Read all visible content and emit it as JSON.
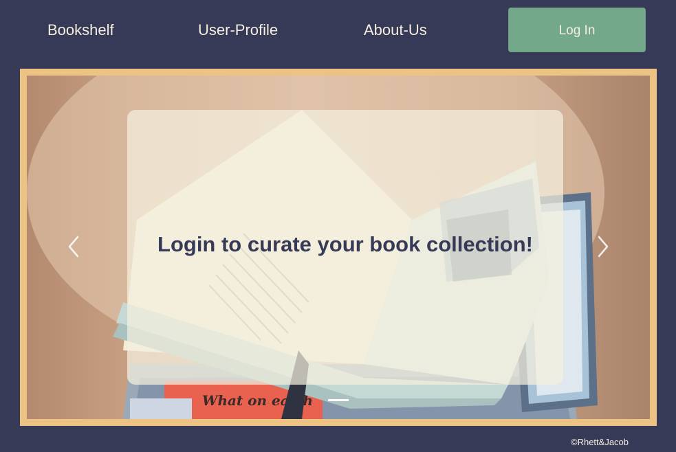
{
  "nav": {
    "links": [
      "Bookshelf",
      "User-Profile",
      "About-Us"
    ],
    "login_label": "Log In"
  },
  "carousel": {
    "caption": "Login to curate your book collection!",
    "prev_icon": "chevron-left-icon",
    "next_icon": "chevron-right-icon",
    "photo_text": "What on earth",
    "slide_count": 1,
    "active_slide": 1
  },
  "footer": {
    "copyright": "©Rhett&Jacob"
  },
  "colors": {
    "background": "#363a57",
    "login_button": "#74a88b",
    "frame": "#edc383",
    "caption_text": "#363a57"
  }
}
